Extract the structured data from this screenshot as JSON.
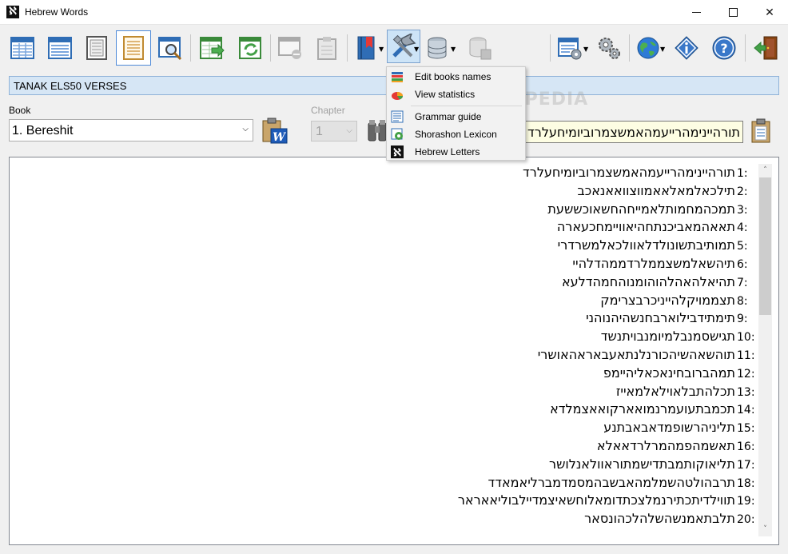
{
  "window": {
    "title": "Hebrew Words",
    "app_icon_glyph": "ℵ",
    "minimize": "–",
    "maximize": "☐",
    "close": "✕"
  },
  "toolbar": {
    "buttons": [
      {
        "name": "table-view-icon",
        "state": "normal"
      },
      {
        "name": "list-view-icon",
        "state": "normal"
      },
      {
        "name": "page-view-icon",
        "state": "normal"
      },
      {
        "name": "verses-view-icon",
        "state": "active"
      },
      {
        "name": "search-document-icon",
        "state": "normal"
      },
      {
        "name": "export-table-icon",
        "state": "normal"
      },
      {
        "name": "refresh-table-icon",
        "state": "normal"
      },
      {
        "name": "remove-window-icon",
        "state": "disabled"
      },
      {
        "name": "clipboard-icon",
        "state": "disabled"
      },
      {
        "name": "bookmark-icon",
        "state": "normal"
      },
      {
        "name": "tools-icon",
        "state": "pressed"
      },
      {
        "name": "database-icon",
        "state": "normal"
      },
      {
        "name": "database-save-icon",
        "state": "disabled"
      },
      {
        "name": "settings-list-icon",
        "state": "normal"
      },
      {
        "name": "gears-icon",
        "state": "normal"
      },
      {
        "name": "globe-icon",
        "state": "normal"
      },
      {
        "name": "info-icon",
        "state": "normal"
      },
      {
        "name": "help-icon",
        "state": "normal"
      },
      {
        "name": "exit-door-icon",
        "state": "normal"
      }
    ]
  },
  "header": {
    "title": "TANAK ELS50 VERSES"
  },
  "book": {
    "label": "Book",
    "value": "1. Bereshit"
  },
  "chapter": {
    "label": "Chapter",
    "value": "1"
  },
  "hebrew_field": {
    "value": "תורהיינימהרייעמהאמשצמרוביומיחעלרד"
  },
  "menu": {
    "items": [
      {
        "label": "Edit books names",
        "icon": "books-icon"
      },
      {
        "label": "View statistics",
        "icon": "statistics-icon"
      },
      {
        "label": "Grammar guide",
        "icon": "grammar-icon"
      },
      {
        "label": "Shorashon Lexicon",
        "icon": "lexicon-icon"
      },
      {
        "label": "Hebrew Letters",
        "icon": "hebrew-letters-icon"
      }
    ]
  },
  "watermark": "SOFTPEDIA",
  "verses": [
    {
      "num": "1:",
      "text": "תורהיינימהרייעמהאמשצמרוביומיחעלרד"
    },
    {
      "num": "2:",
      "text": "תילכאלמאלאאמווצוואאנאכב"
    },
    {
      "num": "3:",
      "text": "תמכהמחמותלאמייחהחשאוכששעת"
    },
    {
      "num": "4:",
      "text": "תאאהמאביכנתחהיאוויימחכעארה"
    },
    {
      "num": "5:",
      "text": "תמותיבתשונולדלאוולכאלמשרדרי"
    },
    {
      "num": "6:",
      "text": "תיהשאלמשצממלרדממהדלהיי"
    },
    {
      "num": "7:",
      "text": "תהיאלהאהלהוהומנוהחמהדלעא"
    },
    {
      "num": "8:",
      "text": "תצממויקלהייניכרבצרימק"
    },
    {
      "num": "9:",
      "text": "תימתידבילוארבחנשהיהנוהני"
    },
    {
      "num": "10:",
      "text": "תגישסמנבלמיומנבויתנשד"
    },
    {
      "num": "11:",
      "text": "תוהשאהשיהכורנלנתאעבאראהאושרי"
    },
    {
      "num": "12:",
      "text": "תמהברובחינאכאליהיימפ"
    },
    {
      "num": "13:",
      "text": "תכלהתבלאוילאלמאייז"
    },
    {
      "num": "14:",
      "text": "תכמבתעועמרנמואארקואאצמלדא"
    },
    {
      "num": "15:",
      "text": "תליניהרשופמדאבאבתנע"
    },
    {
      "num": "16:",
      "text": "תאשמהפמהמרלרדאאלא"
    },
    {
      "num": "17:",
      "text": "תליאוקותמבתדישמתוראוולאנלושר"
    },
    {
      "num": "18:",
      "text": "תרבהולטהשמלמהאבשבהמסמדמברליאמאדד"
    },
    {
      "num": "19:",
      "text": "תווילדיתכתירנמלצכתדומאלוחשאיצמדיילבוליאאראר"
    },
    {
      "num": "20:",
      "text": "תלבתאמנשהשלהלכהונסאר"
    }
  ],
  "scroll": {
    "up": "˄",
    "down": "˅"
  }
}
